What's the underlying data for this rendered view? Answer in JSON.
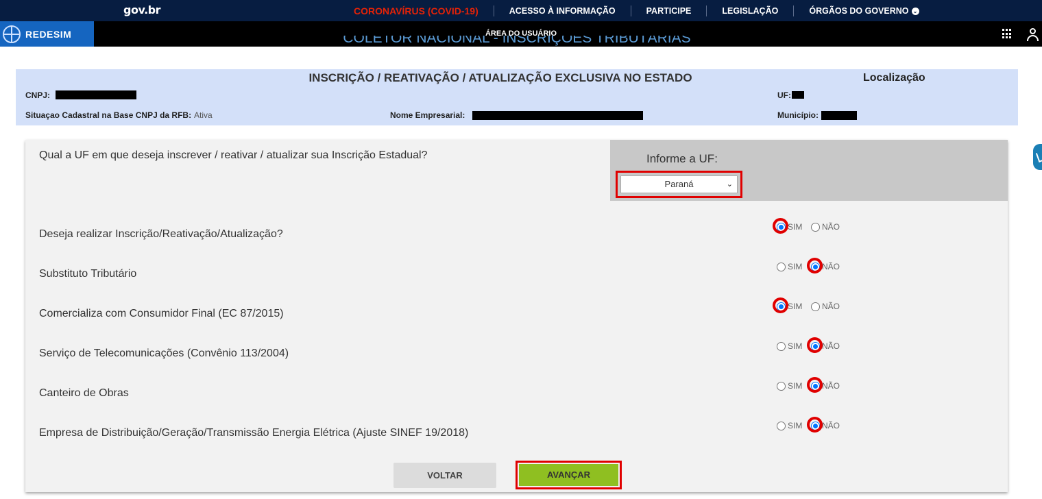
{
  "gov_bar": {
    "logo": "gov.br",
    "links": [
      "CORONAVÍRUS (COVID-19)",
      "ACESSO À INFORMAÇÃO",
      "PARTICIPE",
      "LEGISLAÇÃO",
      "ÓRGÃOS DO GOVERNO"
    ]
  },
  "redesim_bar": {
    "logo": "REDESIM",
    "center_label": "ÁREA DO USUÁRIO"
  },
  "page_title": "COLETOR NACIONAL - INSCRIÇÕES TRIBUTÁRIAS",
  "header": {
    "title": "INSCRIÇÃO / REATIVAÇÃO / ATUALIZAÇÃO EXCLUSIVA NO ESTADO",
    "localizacao_title": "Localização",
    "cnpj_label": "CNPJ:",
    "situacao_label": "Situaçao Cadastral na Base CNPJ da RFB:",
    "situacao_value": "Ativa",
    "nome_label": "Nome Empresarial:",
    "uf_label": "UF:",
    "municipio_label": "Município:"
  },
  "form": {
    "uf_question": "Qual a UF em que deseja inscrever / reativar / atualizar sua Inscrição Estadual?",
    "uf_prompt": "Informe a UF:",
    "uf_selected": "Paraná",
    "yes_label": "SIM",
    "no_label": "NÃO",
    "questions": [
      {
        "text": "Deseja realizar Inscrição/Reativação/Atualização?",
        "answer": "SIM"
      },
      {
        "text": "Substituto Tributário",
        "answer": "NÃO"
      },
      {
        "text": "Comercializa com Consumidor Final (EC 87/2015)",
        "answer": "SIM"
      },
      {
        "text": "Serviço de Telecomunicações (Convênio 113/2004)",
        "answer": "NÃO"
      },
      {
        "text": "Canteiro de Obras",
        "answer": "NÃO"
      },
      {
        "text": "Empresa de Distribuição/Geração/Transmissão Energia Elétrica (Ajuste SINEF 19/2018)",
        "answer": "NÃO"
      }
    ],
    "back_button": "VOLTAR",
    "next_button": "AVANÇAR"
  },
  "colors": {
    "gov_bar": "#071d41",
    "covid_link": "#e52207",
    "header_bg": "#d3e0f9",
    "next_button": "#8fbf21",
    "highlight": "#e00000"
  }
}
